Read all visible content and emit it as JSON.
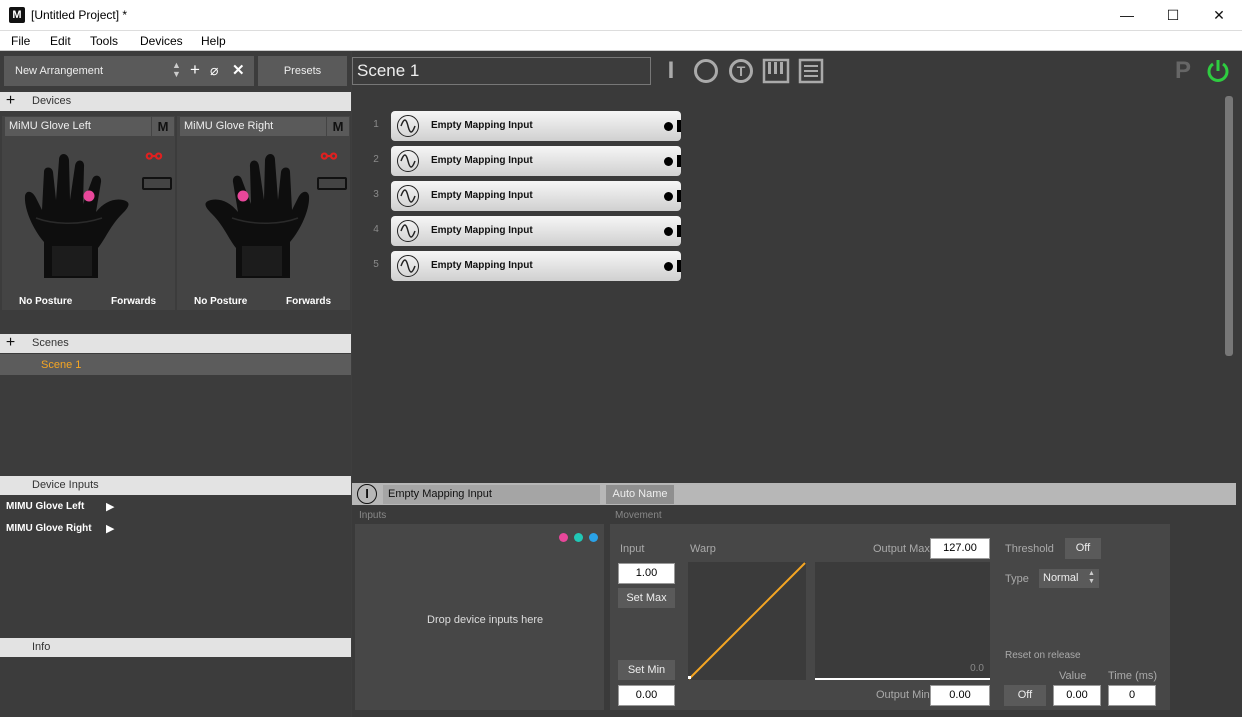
{
  "window": {
    "title": "[Untitled Project] *",
    "min": "—",
    "max": "☐",
    "close": "✕"
  },
  "menu": [
    "File",
    "Edit",
    "Tools",
    "Devices",
    "Help"
  ],
  "arrangement": {
    "name": "New Arrangement",
    "presets": "Presets"
  },
  "devices": {
    "header": "Devices",
    "items": [
      {
        "name": "MiMU Glove Left",
        "mode": "M",
        "posture": "No Posture",
        "orientation": "Forwards"
      },
      {
        "name": "MiMU Glove Right",
        "mode": "M",
        "posture": "No Posture",
        "orientation": "Forwards"
      }
    ]
  },
  "scenes": {
    "header": "Scenes",
    "items": [
      "Scene 1"
    ]
  },
  "device_inputs": {
    "header": "Device Inputs",
    "items": [
      "MIMU Glove Left",
      "MIMU Glove Right"
    ]
  },
  "info": {
    "header": "Info"
  },
  "scene_name": "Scene 1",
  "toolbar_icons": [
    "input-icon",
    "circle-icon",
    "gesture-icon",
    "piano-icon",
    "list-icon"
  ],
  "mapping_inputs": [
    {
      "num": "1",
      "label": "Empty Mapping Input"
    },
    {
      "num": "2",
      "label": "Empty Mapping Input"
    },
    {
      "num": "3",
      "label": "Empty Mapping Input"
    },
    {
      "num": "4",
      "label": "Empty Mapping Input"
    },
    {
      "num": "5",
      "label": "Empty Mapping Input"
    }
  ],
  "editor": {
    "name": "Empty Mapping Input",
    "auto_name": "Auto Name",
    "inputs_label": "Inputs",
    "movement_label": "Movement",
    "drop_hint": "Drop device inputs here",
    "input_label": "Input",
    "input_max": "1.00",
    "set_max": "Set Max",
    "set_min": "Set Min",
    "input_min": "0.00",
    "warp_label": "Warp",
    "output_max_label": "Output Max",
    "output_max": "127.00",
    "output_min_label": "Output Min",
    "output_min": "0.00",
    "output_value": "0.0",
    "threshold_label": "Threshold",
    "threshold": "Off",
    "type_label": "Type",
    "type": "Normal",
    "reset_label": "Reset on release",
    "reset": "Off",
    "value_label": "Value",
    "value": "0.00",
    "time_label": "Time (ms)",
    "time": "0"
  },
  "colors": {
    "accent": "#f5a623",
    "power": "#2ecc40",
    "pink": "#e8479a",
    "teal": "#21c7b5",
    "blue": "#2aa2e8"
  }
}
